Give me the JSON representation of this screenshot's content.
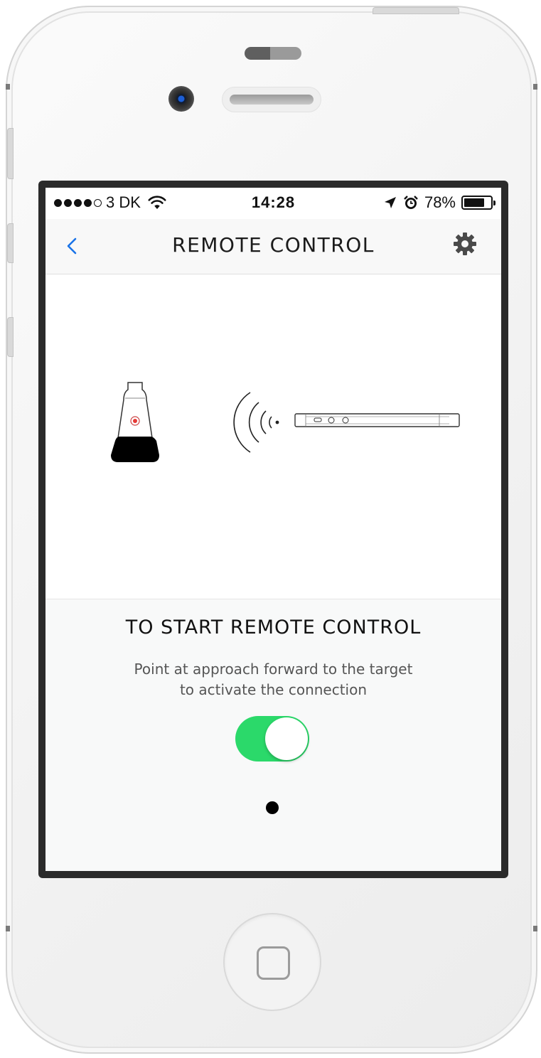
{
  "status_bar": {
    "signal_bars": 4,
    "signal_max": 5,
    "carrier": "3 DK",
    "time": "14:28",
    "battery_percent": "78%",
    "battery_level": 0.78
  },
  "nav": {
    "title": "REMOTE CONTROL",
    "back_icon": "chevron-left-icon",
    "settings_icon": "gear-icon"
  },
  "panel": {
    "title": "TO START REMOTE CONTROL",
    "description_line1": "Point at approach forward to the target",
    "description_line2": "to activate the connection",
    "toggle_on": true,
    "page_indicator": {
      "count": 1,
      "active": 0
    }
  },
  "colors": {
    "accent_blue": "#1a73e8",
    "toggle_green": "#2bd96a",
    "laser_red": "#e53935"
  }
}
